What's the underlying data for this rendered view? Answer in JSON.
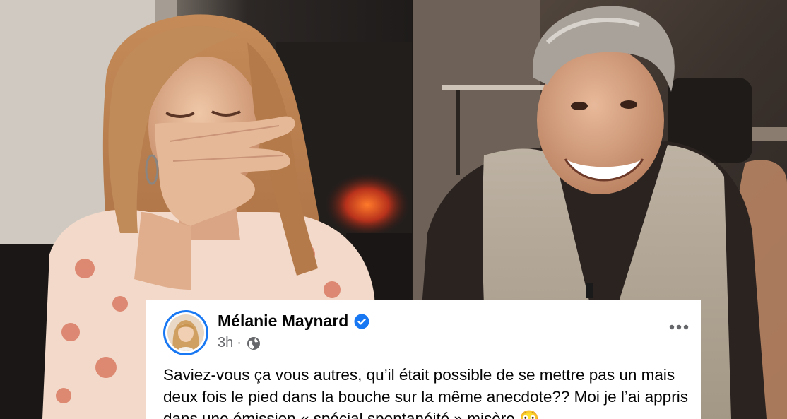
{
  "post": {
    "author": "Mélanie Maynard",
    "time": "3h",
    "separator": "·",
    "body": "Saviez-vous ça vous autres, qu’il était possible de se mettre pas un mais deux fois le pied dans la bouche sur la même anecdote?? Moi je l’ai appris dans une émission « spécial spontanéité » misère 😳"
  },
  "icons": {
    "verified": "verified-badge-icon",
    "audience": "globe-icon",
    "more": "more-options-icon"
  },
  "colors": {
    "verified": "#1877f2",
    "secondary_text": "#65676b",
    "primary_text": "#050505"
  }
}
